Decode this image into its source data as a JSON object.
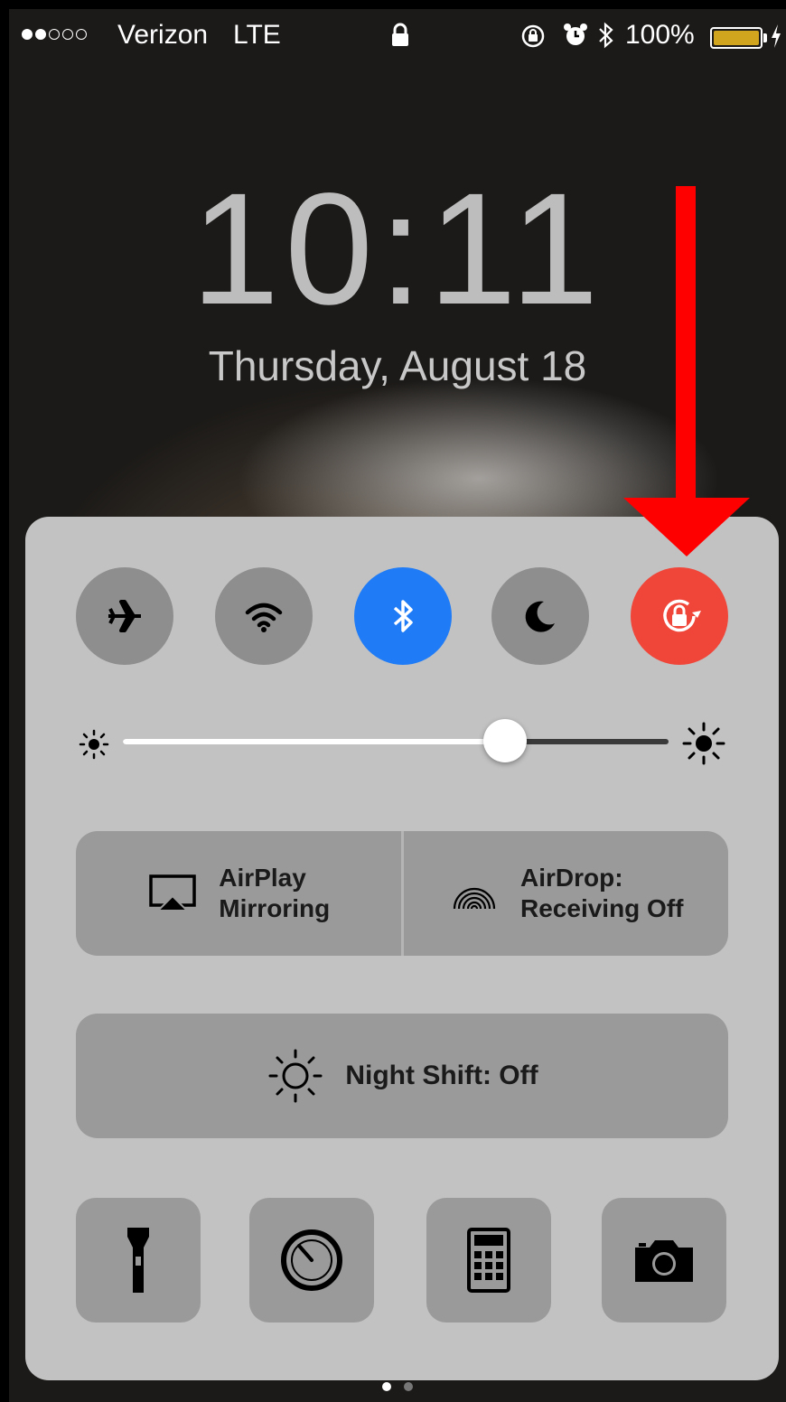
{
  "status_bar": {
    "signal_filled": 2,
    "signal_total": 5,
    "carrier": "Verizon",
    "network": "LTE",
    "battery_percent_text": "100%",
    "battery_level": 1.0,
    "battery_color": "#d2a51e",
    "icons": [
      "lock-icon",
      "rotation-lock-indicator-icon",
      "alarm-icon",
      "bluetooth-icon",
      "charging-bolt-icon"
    ]
  },
  "lock_screen": {
    "time": "10:11",
    "date": "Thursday, August 18"
  },
  "control_center": {
    "toggles": [
      {
        "name": "airplane-mode",
        "icon": "airplane-icon",
        "on": false
      },
      {
        "name": "wifi",
        "icon": "wifi-icon",
        "on": false
      },
      {
        "name": "bluetooth",
        "icon": "bluetooth-icon",
        "on": true,
        "color": "#1f7cf6"
      },
      {
        "name": "do-not-disturb",
        "icon": "moon-icon",
        "on": false
      },
      {
        "name": "rotation-lock",
        "icon": "rotation-lock-icon",
        "on": true,
        "color": "#f0463a"
      }
    ],
    "brightness_level": 0.7,
    "airplay": {
      "line1": "AirPlay",
      "line2": "Mirroring"
    },
    "airdrop": {
      "line1": "AirDrop:",
      "line2": "Receiving Off"
    },
    "night_shift": "Night Shift: Off",
    "tools": [
      "flashlight-icon",
      "timer-icon",
      "calculator-icon",
      "camera-icon"
    ]
  },
  "page_indicator": {
    "pages": 2,
    "current": 1
  },
  "annotation": {
    "arrow_color": "#ff0000"
  }
}
